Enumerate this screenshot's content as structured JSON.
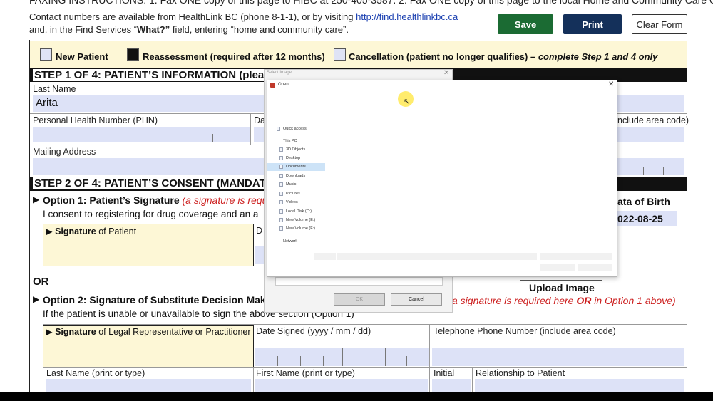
{
  "instructions": {
    "fax_line": "FAXING INSTRUCTIONS:  1. Fax ONE copy of this page to HIBC at 250-405-3587.     2. Fax ONE copy of this page to the local Home and Community Care Office.",
    "contact_line1_prefix": "Contact numbers are available from HealthLink BC (phone 8-1-1), or by visiting ",
    "contact_link": "http://find.healthlinkbc.ca",
    "contact_line2_prefix": "and, in the Find Services “",
    "contact_what": "What?”",
    "contact_line2_suffix": " field, entering “home and community care”."
  },
  "toolbar": {
    "save": "Save",
    "print": "Print",
    "clear": "Clear Form"
  },
  "status_options": {
    "new_patient": "New Patient",
    "reassessment": "Reassessment (required after 12 months)",
    "cancellation": "Cancellation (patient no longer qualifies)",
    "cancellation_note": " – complete Step 1 and 4 only"
  },
  "step1": {
    "title": "STEP 1 OF 4: PATIENT’S INFORMATION (plea",
    "last_name_label": "Last Name",
    "last_name_value": "Arita",
    "phn_label": "Personal Health Number (PHN)",
    "da_label": "Da",
    "phone_partial": "nclude area code)",
    "mailing_label": "Mailing Address"
  },
  "step2": {
    "title": "STEP 2 OF 4: PATIENT’S CONSENT (MANDATO",
    "option1_title": "Option 1: Patient’s Signature",
    "option1_note": " (a signature is requir",
    "dob_label": "ata of Birth",
    "dob_value": "022-08-25",
    "consent_text": "I consent to registering  for drug coverage and an a",
    "sig_patient_bold": "Signature",
    "sig_patient_rest": " of Patient",
    "d_label": "D",
    "or": "OR",
    "option2_title": "Option 2: Signature of Substitute Decision Make",
    "option2_note_a": "a signature is required here ",
    "option2_note_b": "OR",
    "option2_note_c": " in Option 1 above)",
    "unable_text": "If the patient is unable or unavailable to sign the above section (Option 1)",
    "upload_label": "Upload Image",
    "sig_rep_bold": "Signature",
    "sig_rep_rest": " of Legal Representative or Practitioner",
    "date_signed": "Date Signed (yyyy / mm / dd)",
    "telephone": "Telephone Phone Number (include area code)",
    "last_name_print": "Last Name (print or type)",
    "first_name_print": "First Name (print or type)",
    "initial": "Initial",
    "relationship": "Relationship to Patient"
  },
  "dialog": {
    "outer_title": "Select Image",
    "open_title": "Open",
    "nav": [
      "Quick access",
      "This PC",
      "3D Objects",
      "Desktop",
      "Documents",
      "Downloads",
      "Music",
      "Pictures",
      "Videos",
      "Local Disk (C:)",
      "New Volume (E:)",
      "New Volume (F:)",
      "Network"
    ],
    "ok": "OK",
    "cancel": "Cancel"
  }
}
